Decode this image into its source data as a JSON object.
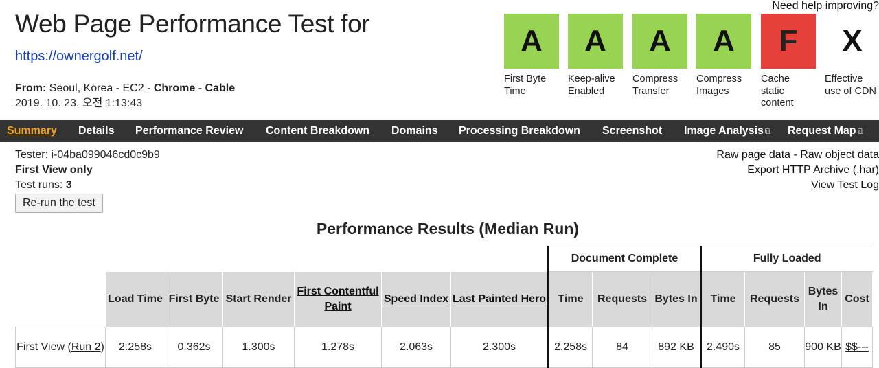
{
  "help_link": "Need help improving?",
  "header": {
    "title": "Web Page Performance Test for",
    "url": "https://ownergolf.net/",
    "from_label": "From:",
    "from_location": " Seoul, Korea - EC2 - ",
    "browser": "Chrome",
    "sep": " - ",
    "connection": "Cable",
    "timestamp": "2019. 10. 23. 오전 1:13:43"
  },
  "grades": [
    {
      "grade": "A",
      "label": "First Byte Time",
      "status": "green"
    },
    {
      "grade": "A",
      "label": "Keep-alive Enabled",
      "status": "green"
    },
    {
      "grade": "A",
      "label": "Compress Transfer",
      "status": "green"
    },
    {
      "grade": "A",
      "label": "Compress Images",
      "status": "green"
    },
    {
      "grade": "F",
      "label": "Cache static content",
      "status": "red"
    },
    {
      "grade": "X",
      "label": "Effective use of CDN",
      "status": "none"
    }
  ],
  "colors": {
    "green": "#98d353",
    "red": "#e5403a",
    "nav_bg": "#333333",
    "nav_active": "#f2a31a"
  },
  "nav": {
    "summary": "Summary",
    "details": "Details",
    "performance_review": "Performance Review",
    "content_breakdown": "Content Breakdown",
    "domains": "Domains",
    "processing_breakdown": "Processing Breakdown",
    "screenshot": "Screenshot",
    "image_analysis": "Image Analysis",
    "request_map": "Request Map",
    "external_icon": "external-link-icon"
  },
  "test_info": {
    "tester": "Tester: i-04ba099046cd0c9b9",
    "view": "First View only",
    "runs_label": "Test runs: ",
    "runs": "3",
    "rerun": "Re-run the test"
  },
  "raw_links": {
    "raw_page": "Raw page data",
    "sep": " - ",
    "raw_object": "Raw object data",
    "export": "Export HTTP Archive (.har)",
    "log": "View Test Log"
  },
  "results": {
    "title": "Performance Results (Median Run)",
    "group_document": "Document Complete",
    "group_fully": "Fully Loaded",
    "headers": {
      "load_time": "Load Time",
      "first_byte": "First Byte",
      "start_render": "Start Render",
      "fcp": "First Contentful Paint",
      "speed_index": "Speed Index",
      "lph": "Last Painted Hero",
      "doc_time": "Time",
      "doc_requests": "Requests",
      "doc_bytes": "Bytes In",
      "full_time": "Time",
      "full_requests": "Requests",
      "full_bytes": "Bytes In",
      "cost": "Cost"
    },
    "row": {
      "label_prefix": "First View (",
      "run_link": "Run 2",
      "label_suffix": ")",
      "load_time": "2.258s",
      "first_byte": "0.362s",
      "start_render": "1.300s",
      "fcp": "1.278s",
      "speed_index": "2.063s",
      "lph": "2.300s",
      "doc_time": "2.258s",
      "doc_requests": "84",
      "doc_bytes": "892 KB",
      "full_time": "2.490s",
      "full_requests": "85",
      "full_bytes": "900 KB",
      "cost": "$$---"
    }
  }
}
